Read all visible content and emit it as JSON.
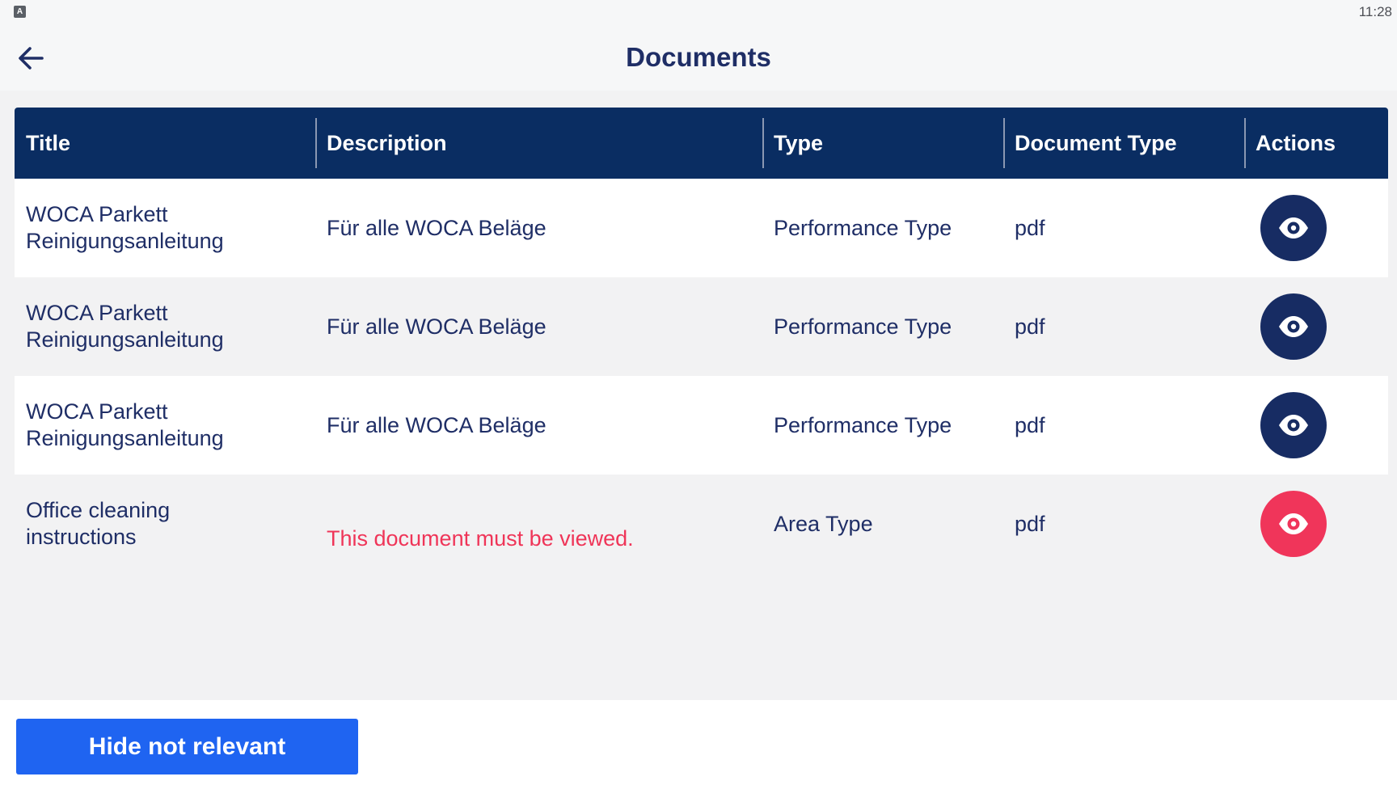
{
  "status_bar": {
    "app_icon_letter": "A",
    "time": "11:28"
  },
  "header": {
    "title": "Documents",
    "back_icon": "arrow-left-icon"
  },
  "table": {
    "columns": [
      "Title",
      "Description",
      "Type",
      "Document Type",
      "Actions"
    ],
    "rows": [
      {
        "title_line1": "WOCA Parkett",
        "title_line2": "Reinigungsanleitung",
        "description": "Für alle WOCA Beläge",
        "type": "Performance Type",
        "document_type": "pdf",
        "action_icon": "eye-icon"
      },
      {
        "title_line1": "WOCA Parkett",
        "title_line2": "Reinigungsanleitung",
        "description": "Für alle WOCA Beläge",
        "type": "Performance Type",
        "document_type": "pdf",
        "action_icon": "eye-icon"
      },
      {
        "title_line1": "WOCA Parkett",
        "title_line2": "Reinigungsanleitung",
        "description": "Für alle WOCA Beläge",
        "type": "Performance Type",
        "document_type": "pdf",
        "action_icon": "eye-icon"
      },
      {
        "title_line1": "Office cleaning",
        "title_line2": "instructions",
        "description": "This document must be viewed.",
        "type": "Area Type",
        "document_type": "pdf",
        "action_icon": "eye-icon"
      }
    ]
  },
  "footer": {
    "hide_button_label": "Hide not relevant"
  },
  "colors": {
    "header_bg": "#0a2d62",
    "primary_text": "#1f2e66",
    "alert": "#f0355a",
    "button_blue": "#1f64f1"
  }
}
